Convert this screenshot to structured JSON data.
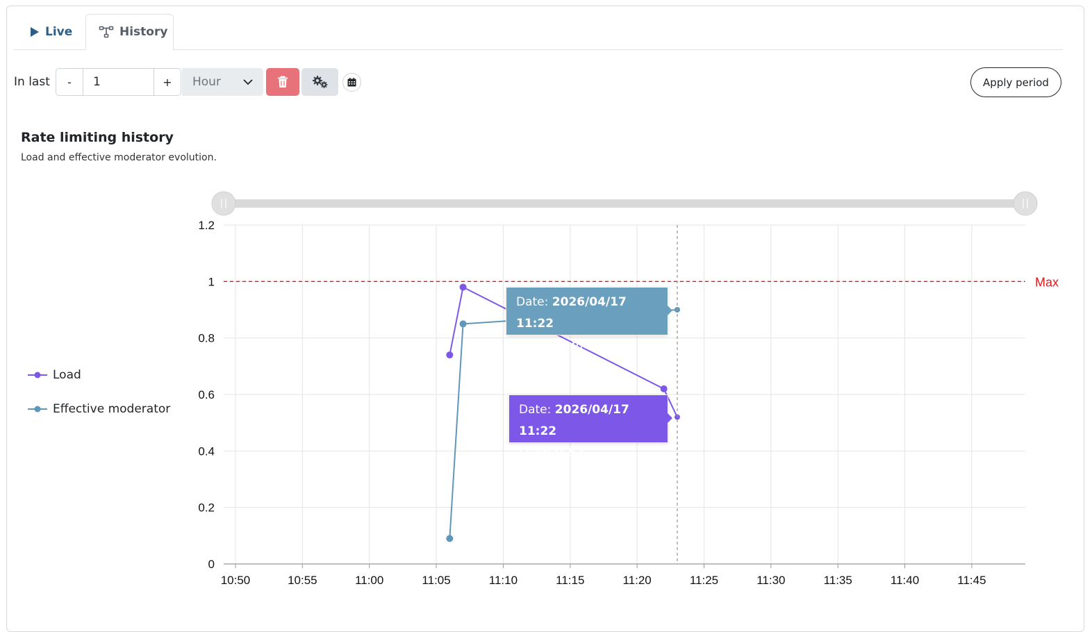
{
  "tabs": [
    {
      "label": "Live",
      "icon": "play-icon"
    },
    {
      "label": "History",
      "icon": "sitemap-icon",
      "active": true
    }
  ],
  "controls": {
    "in_last_label": "In last",
    "minus_label": "-",
    "plus_label": "+",
    "amount": "1",
    "unit": "Hour",
    "apply_label": "Apply period",
    "icons": [
      "trash-icon",
      "gears-icon",
      "calendar-icon",
      "chevron-down-icon"
    ]
  },
  "chart_data": {
    "type": "line",
    "title": "Rate limiting history",
    "subtitle": "Load and effective moderator evolution.",
    "x_ticks": [
      "10:50",
      "10:55",
      "11:00",
      "11:05",
      "11:10",
      "11:15",
      "11:20",
      "11:25",
      "11:30",
      "11:35",
      "11:40",
      "11:45"
    ],
    "y_ticks": [
      "1.2",
      "1",
      "0.8",
      "0.6",
      "0.4",
      "0.2",
      "0"
    ],
    "ylim": [
      0,
      1.2
    ],
    "xlim": [
      "10:50",
      "11:49"
    ],
    "grid": true,
    "legend_position": "left",
    "series": [
      {
        "name": "Load",
        "color": "#7c57e8",
        "x": [
          "11:06",
          "11:07",
          "11:22",
          "11:23"
        ],
        "y": [
          0.74,
          0.98,
          0.62,
          0.52
        ]
      },
      {
        "name": "Effective moderator",
        "color": "#5f96b9",
        "x": [
          "11:06",
          "11:07",
          "11:23"
        ],
        "y": [
          0.09,
          0.85,
          0.9
        ]
      }
    ],
    "threshold": {
      "label": "Max",
      "value": 1,
      "color": "#e0191e"
    },
    "cursor_x": "11:23",
    "tooltips": [
      {
        "series": "Effective moderator",
        "date_label": "Date:",
        "date": "2026/04/17 11:22",
        "value_label": "Effective moderator:",
        "value": "0.9"
      },
      {
        "series": "Load",
        "date_label": "Date:",
        "date": "2026/04/17 11:22",
        "value_label": "Load:",
        "value": "0.52"
      }
    ]
  }
}
